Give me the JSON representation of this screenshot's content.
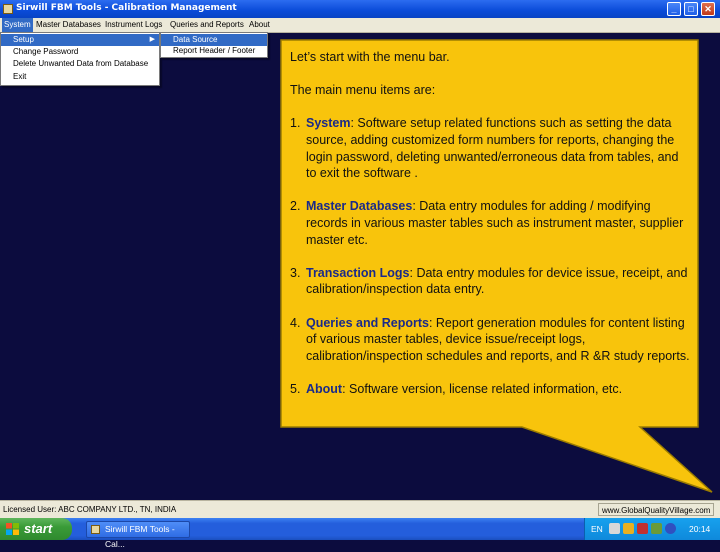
{
  "window": {
    "title": "Sirwill FBM Tools - Calibration Management",
    "min": "_",
    "max": "□",
    "close": "✕"
  },
  "menubar": {
    "items": [
      "System",
      "Master Databases",
      "Instrument Logs",
      "Queries and Reports",
      "About"
    ]
  },
  "system_menu": {
    "items": [
      "Setup",
      "Change Password",
      "Delete Unwanted Data from Database",
      "Exit"
    ],
    "arrow": "▶"
  },
  "setup_submenu": {
    "items": [
      "Data Source",
      "Report Header / Footer"
    ]
  },
  "callout": {
    "intro": "Let’s start with the menu bar.",
    "lead": "The main menu items are:",
    "points": [
      {
        "num": "1.",
        "keyword": "System",
        "text": ": Software setup related functions such as setting the data source, adding customized form numbers for reports, changing the login password, deleting unwanted/erroneous data from tables, and to exit the software ."
      },
      {
        "num": "2.",
        "keyword": "Master Databases",
        "text": ": Data entry modules for adding / modifying records in various master tables such as instrument master, supplier master etc."
      },
      {
        "num": "3.",
        "keyword": "Transaction Logs",
        "text": ": Data entry modules for device issue, receipt, and calibration/inspection data entry."
      },
      {
        "num": "4.",
        "keyword": "Queries and Reports",
        "text": ": Report generation modules for content listing of various master tables, device issue/receipt logs, calibration/inspection schedules and reports, and R &R study reports."
      },
      {
        "num": "5.",
        "keyword": "About",
        "text": ": Software version, license related information, etc."
      }
    ],
    "colors": {
      "fill": "#f8c40c",
      "border": "#9b7c00",
      "keyword": "#1a2a8a"
    }
  },
  "statusbar": {
    "license": "Licensed User: ABC COMPANY LTD., TN, INDIA",
    "website": "www.GlobalQualityVillage.com"
  },
  "taskbar": {
    "start": "start",
    "task_label": "Sirwill FBM Tools - Cal...",
    "language": "EN",
    "clock": "20:14"
  },
  "colors": {
    "desktop": "#0c0c3e",
    "menu_highlight": "#316ac5",
    "taskbar": "#245edc"
  }
}
